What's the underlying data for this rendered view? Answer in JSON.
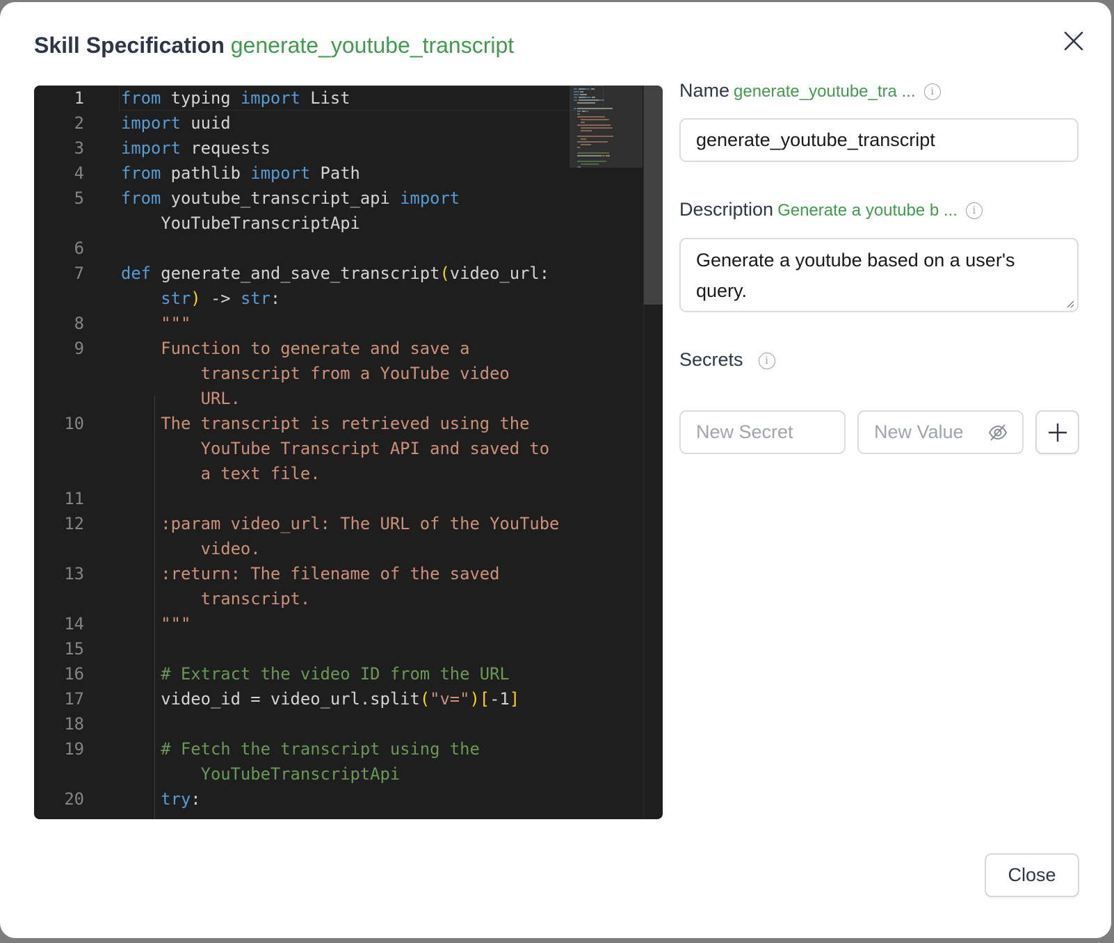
{
  "header": {
    "title": "Skill Specification",
    "skill_name": "generate_youtube_transcript",
    "close_icon": "close-x-icon"
  },
  "editor": {
    "colors": {
      "background": "#1e1e1e",
      "keyword": "#569cd6",
      "string": "#ce9178",
      "comment": "#6a9955",
      "text": "#d4d4d4"
    },
    "rows": [
      {
        "n": "1",
        "s": [
          [
            "kw",
            "from"
          ],
          [
            "tx",
            " typing "
          ],
          [
            "kw",
            "import"
          ],
          [
            "tx",
            " List"
          ]
        ]
      },
      {
        "n": "2",
        "s": [
          [
            "kw",
            "import"
          ],
          [
            "tx",
            " uuid"
          ]
        ]
      },
      {
        "n": "3",
        "s": [
          [
            "kw",
            "import"
          ],
          [
            "tx",
            " requests"
          ]
        ]
      },
      {
        "n": "4",
        "s": [
          [
            "kw",
            "from"
          ],
          [
            "tx",
            " pathlib "
          ],
          [
            "kw",
            "import"
          ],
          [
            "tx",
            " Path"
          ]
        ]
      },
      {
        "n": "5",
        "s": [
          [
            "kw",
            "from"
          ],
          [
            "tx",
            " youtube_transcript_api "
          ],
          [
            "kw",
            "import"
          ]
        ]
      },
      {
        "n": "",
        "s": [
          [
            "tx",
            "    YouTubeTranscriptApi"
          ]
        ]
      },
      {
        "n": "6",
        "s": []
      },
      {
        "n": "7",
        "s": [
          [
            "kw",
            "def"
          ],
          [
            "tx",
            " generate_and_save_transcript"
          ],
          [
            "br",
            "("
          ],
          [
            "tx",
            "video_url:"
          ]
        ]
      },
      {
        "n": "",
        "s": [
          [
            "kw",
            "    str"
          ],
          [
            "br",
            ")"
          ],
          [
            "tx",
            " -> "
          ],
          [
            "kw",
            "str"
          ],
          [
            "tx",
            ":"
          ]
        ]
      },
      {
        "n": "8",
        "s": [
          [
            "st",
            "    \"\"\""
          ]
        ]
      },
      {
        "n": "9",
        "s": [
          [
            "st",
            "    Function to generate and save a"
          ]
        ]
      },
      {
        "n": "",
        "s": [
          [
            "st",
            "        transcript from a YouTube video"
          ]
        ]
      },
      {
        "n": "",
        "s": [
          [
            "st",
            "        URL."
          ]
        ]
      },
      {
        "n": "10",
        "s": [
          [
            "st",
            "    The transcript is retrieved using the"
          ]
        ]
      },
      {
        "n": "",
        "s": [
          [
            "st",
            "        YouTube Transcript API and saved to"
          ]
        ]
      },
      {
        "n": "",
        "s": [
          [
            "st",
            "        a text file."
          ]
        ]
      },
      {
        "n": "11",
        "s": []
      },
      {
        "n": "12",
        "s": [
          [
            "st",
            "    :param video_url: The URL of the YouTube"
          ]
        ]
      },
      {
        "n": "",
        "s": [
          [
            "st",
            "        video."
          ]
        ]
      },
      {
        "n": "13",
        "s": [
          [
            "st",
            "    :return: The filename of the saved"
          ]
        ]
      },
      {
        "n": "",
        "s": [
          [
            "st",
            "        transcript."
          ]
        ]
      },
      {
        "n": "14",
        "s": [
          [
            "st",
            "    \"\"\""
          ]
        ]
      },
      {
        "n": "15",
        "s": []
      },
      {
        "n": "16",
        "s": [
          [
            "cm",
            "    # Extract the video ID from the URL"
          ]
        ]
      },
      {
        "n": "17",
        "s": [
          [
            "tx",
            "    video_id = video_url.split"
          ],
          [
            "br",
            "("
          ],
          [
            "st",
            "\"v=\""
          ],
          [
            "br",
            ")"
          ],
          [
            "br",
            "["
          ],
          [
            "tx",
            "-1"
          ],
          [
            "br",
            "]"
          ]
        ]
      },
      {
        "n": "18",
        "s": []
      },
      {
        "n": "19",
        "s": [
          [
            "cm",
            "    # Fetch the transcript using the"
          ]
        ]
      },
      {
        "n": "",
        "s": [
          [
            "cm",
            "        YouTubeTranscriptApi"
          ]
        ]
      },
      {
        "n": "20",
        "s": [
          [
            "kw",
            "    try"
          ],
          [
            "tx",
            ":"
          ]
        ]
      }
    ]
  },
  "form": {
    "name": {
      "label": "Name",
      "preview": "generate_youtube_tra ...",
      "value": "generate_youtube_transcript"
    },
    "description": {
      "label": "Description",
      "preview": "Generate a youtube b ...",
      "value": "Generate a youtube based on a user's query."
    },
    "secrets": {
      "label": "Secrets",
      "secret_placeholder": "New Secret",
      "value_placeholder": "New Value"
    },
    "info_glyph": "i"
  },
  "footer": {
    "close_label": "Close"
  },
  "accent_color": "#3f9c4a"
}
